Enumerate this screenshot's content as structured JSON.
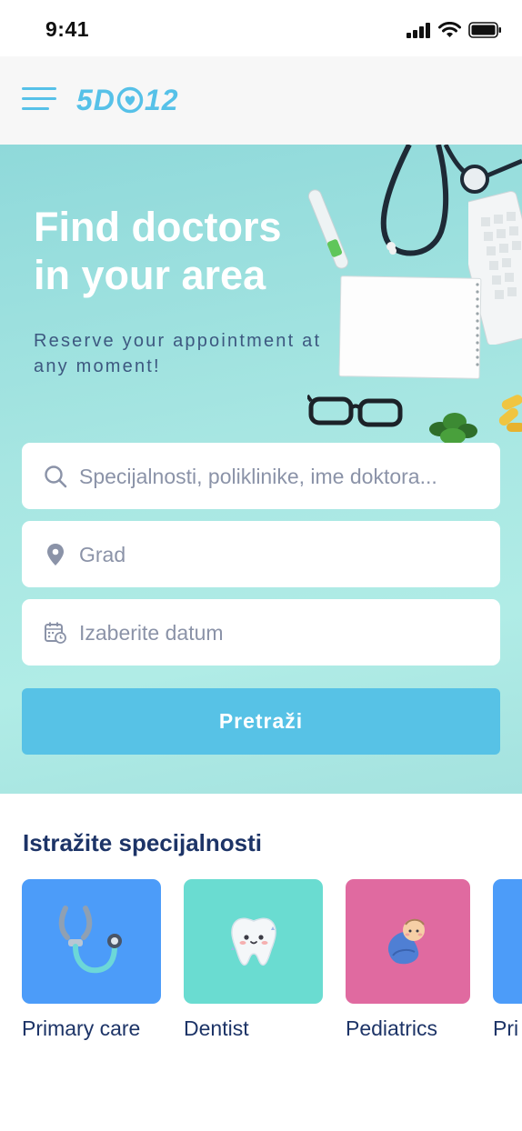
{
  "status_bar": {
    "time": "9:41"
  },
  "header": {
    "logo_text_left": "5D",
    "logo_text_right": "12"
  },
  "hero": {
    "title": "Find doctors in your area",
    "subtitle": "Reserve your appointment at any moment!"
  },
  "search": {
    "query_placeholder": "Specijalnosti, poliklinike, ime doktora...",
    "city_placeholder": "Grad",
    "date_placeholder": "Izaberite datum",
    "button_label": "Pretraži"
  },
  "specialties": {
    "title": "Istražite specijalnosti",
    "items": [
      {
        "label": "Primary care",
        "color": "#4c9cf9",
        "icon": "stethoscope-icon"
      },
      {
        "label": "Dentist",
        "color": "#6adcd1",
        "icon": "tooth-icon"
      },
      {
        "label": "Pediatrics",
        "color": "#e06aa0",
        "icon": "baby-icon"
      },
      {
        "label": "Pri",
        "color": "#4c9cf9",
        "icon": "stethoscope-icon"
      }
    ]
  },
  "colors": {
    "accent": "#56c1e8",
    "heading": "#1d3467",
    "button": "#57c2e6"
  }
}
